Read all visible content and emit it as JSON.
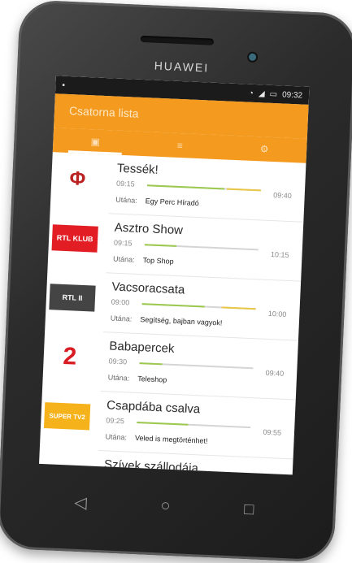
{
  "device": {
    "brand": "HUAWEI"
  },
  "status_bar": {
    "time": "09:32"
  },
  "app": {
    "title": "Csatorna lista"
  },
  "tabs": [
    {
      "icon": "tv-icon",
      "glyph": "▣"
    },
    {
      "icon": "list-icon",
      "glyph": "≡"
    },
    {
      "icon": "settings-icon",
      "glyph": "⚙"
    }
  ],
  "programs": [
    {
      "channel_logo": "Φ",
      "title": "Tessék!",
      "start": "09:15",
      "end": "09:40",
      "next_label": "Utána:",
      "next_title": "Egy Perc Híradó",
      "progress": 0.68,
      "warn": true
    },
    {
      "channel_logo": "RTL KLUB",
      "title": "Asztro Show",
      "start": "09:15",
      "end": "10:15",
      "next_label": "Utána:",
      "next_title": "Top Shop",
      "progress": 0.28,
      "warn": false
    },
    {
      "channel_logo": "RTL II",
      "title": "Vacsoracsata",
      "start": "09:00",
      "end": "10:00",
      "next_label": "Utána:",
      "next_title": "Segítség, bajban vagyok!",
      "progress": 0.55,
      "warn": true
    },
    {
      "channel_logo": "2",
      "title": "Babapercek",
      "start": "09:30",
      "end": "09:40",
      "next_label": "Utána:",
      "next_title": "Teleshop",
      "progress": 0.2,
      "warn": false
    },
    {
      "channel_logo": "SUPER TV2",
      "title": "Csapdába csalva",
      "start": "09:25",
      "end": "09:55",
      "next_label": "Utána:",
      "next_title": "Veled is megtörténhet!",
      "progress": 0.45,
      "warn": false
    },
    {
      "channel_logo": "",
      "title": "Szívek szállodája",
      "start": "",
      "end": "",
      "next_label": "",
      "next_title": "",
      "progress": 0,
      "warn": false
    }
  ],
  "nav": {
    "back": "◁",
    "home": "○",
    "recent": "□"
  },
  "colors": {
    "accent": "#f39a1f",
    "progress": "#9bc94e",
    "warn": "#e9c646"
  }
}
